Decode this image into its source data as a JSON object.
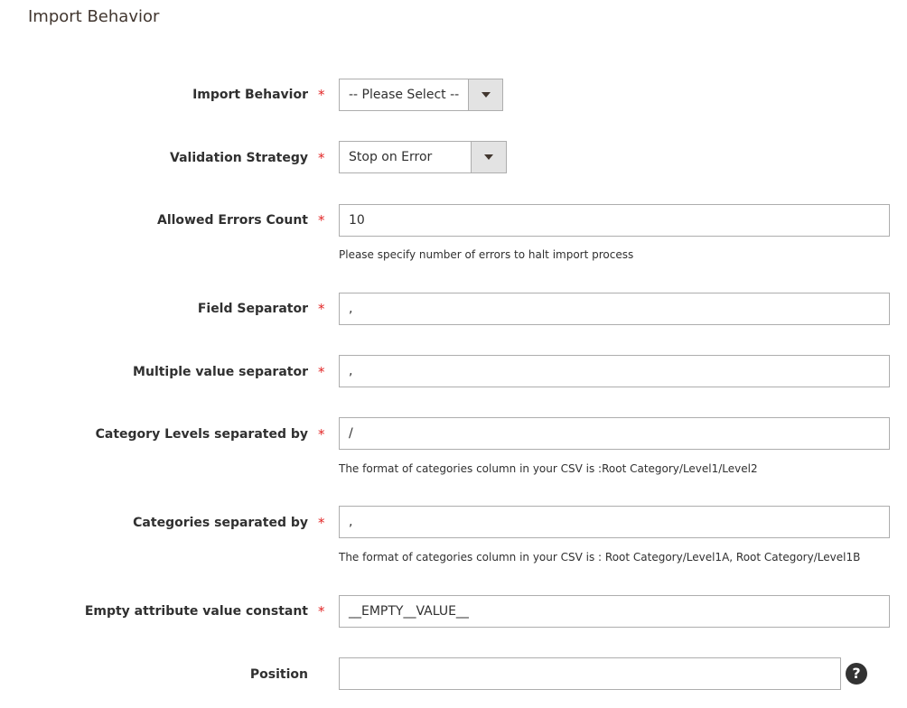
{
  "section": {
    "title": "Import Behavior"
  },
  "fields": {
    "import_behavior": {
      "label": "Import Behavior",
      "required": "*",
      "value": "-- Please Select --"
    },
    "validation_strategy": {
      "label": "Validation Strategy",
      "required": "*",
      "value": "Stop on Error"
    },
    "allowed_errors_count": {
      "label": "Allowed Errors Count",
      "required": "*",
      "value": "10",
      "note": "Please specify number of errors to halt import process"
    },
    "field_separator": {
      "label": "Field Separator",
      "required": "*",
      "value": ","
    },
    "multiple_value_separator": {
      "label": "Multiple value separator",
      "required": "*",
      "value": ","
    },
    "category_levels_separator": {
      "label": "Category Levels separated by",
      "required": "*",
      "value": "/",
      "note": "The format of categories column in your CSV is :Root Category/Level1/Level2"
    },
    "categories_separator": {
      "label": "Categories separated by",
      "required": "*",
      "value": ",",
      "note": "The format of categories column in your CSV is : Root Category/Level1A, Root Category/Level1B"
    },
    "empty_attribute_constant": {
      "label": "Empty attribute value constant",
      "required": "*",
      "value": "__EMPTY__VALUE__"
    },
    "position": {
      "label": "Position",
      "value": ""
    }
  },
  "help": {
    "glyph": "?",
    "icon": "question-circle-icon"
  }
}
